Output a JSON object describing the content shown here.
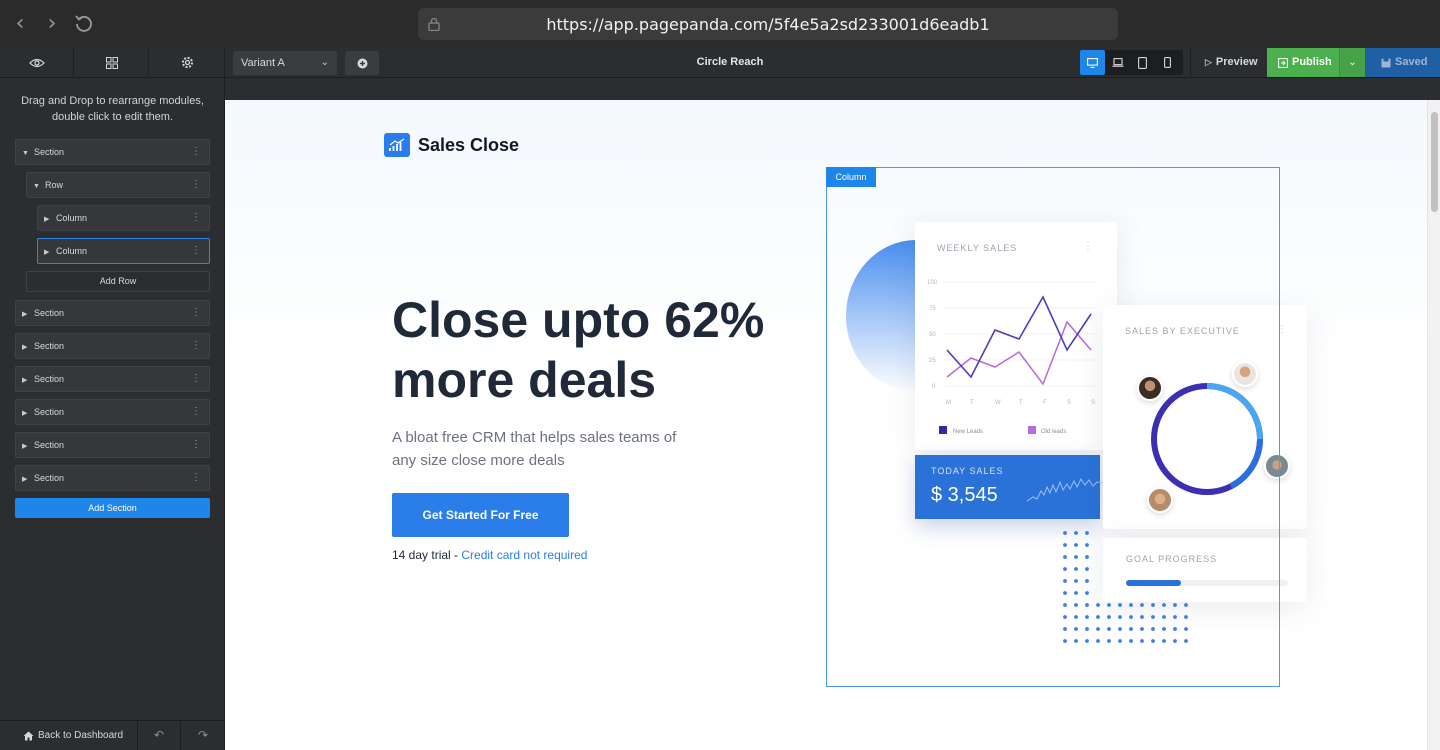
{
  "browser": {
    "url": "https://app.pagepanda.com/5f4e5a2sd233001d6eadb1"
  },
  "toolbar": {
    "variant": "Variant A",
    "page_title": "Circle Reach",
    "preview_label": "Preview",
    "publish_label": "Publish",
    "saved_label": "Saved",
    "active_device": "desktop",
    "accent_color": "#1e86e8",
    "publish_color": "#4cb04f"
  },
  "panel": {
    "help_line1": "Drag and Drop to rearrange modules,",
    "help_line2": "double click to edit them.",
    "tree": [
      {
        "label": "Section",
        "expanded": true
      },
      {
        "label": "Row",
        "expanded": true
      },
      {
        "label": "Column",
        "expanded": false
      },
      {
        "label": "Column",
        "expanded": false,
        "selected": true
      }
    ],
    "add_row_label": "Add Row",
    "sections": [
      "Section",
      "Section",
      "Section",
      "Section",
      "Section",
      "Section"
    ],
    "add_section_label": "Add Section",
    "back_label": "Back to Dashboard"
  },
  "page": {
    "brand": "Sales Close",
    "headline_line1": "Close upto 62%",
    "headline_line2": "more deals",
    "subtitle_line1": "A bloat free CRM that helps sales teams of",
    "subtitle_line2": "any size close more deals",
    "cta_label": "Get Started For Free",
    "trial_prefix": "14 day trial -",
    "trial_link": "Credit card not required",
    "column_tag": "Column",
    "weekly_sales_label": "WEEKLY SALES",
    "legend_new": "New Leads",
    "legend_old": "Old leads",
    "days": [
      "M",
      "T",
      "W",
      "T",
      "F",
      "S",
      "S"
    ],
    "y_ticks": [
      "100",
      "75",
      "50",
      "25",
      "0"
    ],
    "today_label": "TODAY SALES",
    "today_value": "$ 3,545",
    "exec_label": "SALES BY EXECUTIVE",
    "goal_label": "GOAL PROGRESS",
    "goal_progress_fraction": 0.34
  }
}
